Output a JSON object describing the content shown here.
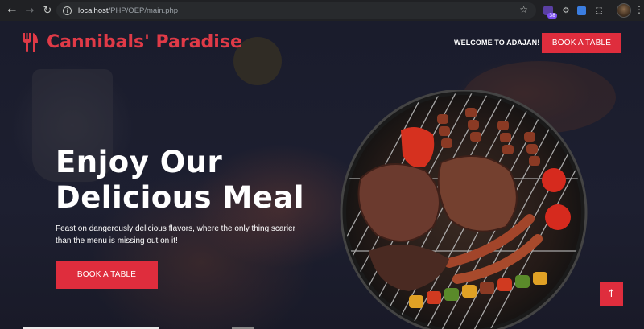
{
  "browser": {
    "url_host": "localhost",
    "url_path": "/PHP/OEP/main.php",
    "extension_badge": "38"
  },
  "header": {
    "brand": "Cannibals' Paradise",
    "welcome": "WELCOME TO ADAJAN!",
    "book_button": "BOOK A TABLE"
  },
  "hero": {
    "headline_line1": "Enjoy Our",
    "headline_line2": "Delicious Meal",
    "tagline": "Feast on dangerously delicious flavors, where the only thing scarier than the menu is missing out on it!",
    "book_button": "BOOK A TABLE"
  },
  "icons": {
    "brand": "utensils-icon",
    "scroll_top": "arrow-up-icon"
  },
  "colors": {
    "accent": "#df2d3d",
    "background": "#1b1d2e"
  }
}
